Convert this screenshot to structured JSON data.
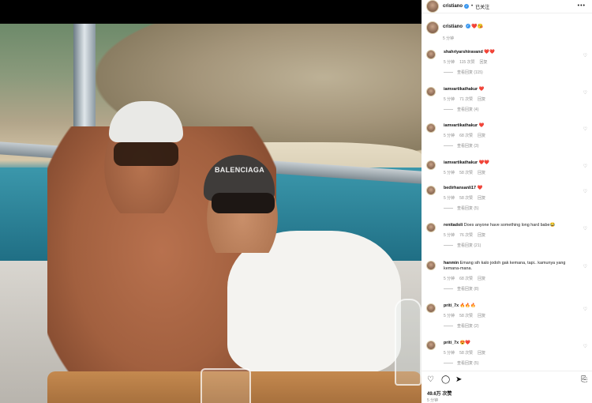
{
  "post": {
    "author": "cristiano",
    "follow_separator": "•",
    "follow_status": "已关注",
    "more_icon": "more-horizontal-icon",
    "caption_emojis": "❤️😘",
    "caption_time": "5 分钟",
    "cap_text": "BALENCIAGA"
  },
  "comments": [
    {
      "user": "shahriyarshiravand",
      "text": "❤️❤️",
      "time": "5 分钟",
      "likes": "115 次赞",
      "reply": "回复",
      "replies": "查看回复 (115)"
    },
    {
      "user": "iamvartikathakur",
      "text": "❤️",
      "time": "5 分钟",
      "likes": "71 次赞",
      "reply": "回复",
      "replies": "查看回复 (4)"
    },
    {
      "user": "iamvartikathakur",
      "text": "❤️",
      "time": "5 分钟",
      "likes": "68 次赞",
      "reply": "回复",
      "replies": "查看回复 (3)"
    },
    {
      "user": "iamvartikathakur",
      "text": "❤️❤️",
      "time": "5 分钟",
      "likes": "58 次赞",
      "reply": "回复",
      "replies": ""
    },
    {
      "user": "bedirhansanli17",
      "text": "❤️",
      "time": "5 分钟",
      "likes": "58 次赞",
      "reply": "回复",
      "replies": "查看回复 (5)"
    },
    {
      "user": "renitadoli",
      "text": "Does anyone have something long hard babe😂",
      "time": "5 分钟",
      "likes": "76 次赞",
      "reply": "回复",
      "replies": "查看回复 (21)"
    },
    {
      "user": "hanmin",
      "text": "Emang sih kalo jodoh gak kemana, tapi.. kamunya yang kemana-mana.",
      "time": "5 分钟",
      "likes": "68 次赞",
      "reply": "回复",
      "replies": "查看回复 (8)"
    },
    {
      "user": "priti_7x",
      "text": "🔥🔥🔥",
      "time": "5 分钟",
      "likes": "58 次赞",
      "reply": "回复",
      "replies": "查看回复 (2)"
    },
    {
      "user": "priti_7x",
      "text": "😍❤️",
      "time": "5 分钟",
      "likes": "58 次赞",
      "reply": "回复",
      "replies": "查看回复 (5)"
    }
  ],
  "footer": {
    "likes": "49.6万 次赞",
    "time": "5 分钟",
    "icons": [
      "heart-icon",
      "comment-icon",
      "share-icon",
      "bookmark-icon"
    ]
  },
  "colors": {
    "verified": "#3897f0",
    "heart": "#e0245e",
    "meta": "#8e8e8e"
  }
}
